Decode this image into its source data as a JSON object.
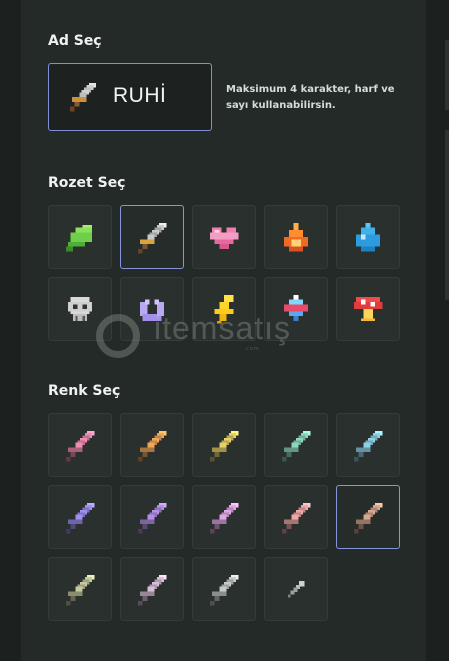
{
  "name_section": {
    "title": "Ad Seç",
    "value": "RUHİ",
    "hint": "Maksimum 4 karakter, harf ve sayı kullanabilirsin."
  },
  "badge_section": {
    "title": "Rozet Seç",
    "badges": [
      {
        "icon": "leaf-icon",
        "selected": false
      },
      {
        "icon": "sword-icon",
        "selected": true
      },
      {
        "icon": "heart-icon",
        "selected": false
      },
      {
        "icon": "fire-icon",
        "selected": false
      },
      {
        "icon": "water-drop-icon",
        "selected": false
      },
      {
        "icon": "skull-icon",
        "selected": false
      },
      {
        "icon": "crescent-moon-icon",
        "selected": false
      },
      {
        "icon": "lightning-icon",
        "selected": false
      },
      {
        "icon": "gem-icon",
        "selected": false
      },
      {
        "icon": "mushroom-icon",
        "selected": false
      }
    ]
  },
  "color_section": {
    "title": "Renk Seç",
    "colors": [
      {
        "blade": "#f08bb0",
        "selected": false
      },
      {
        "blade": "#f0a65a",
        "selected": false
      },
      {
        "blade": "#e6d068",
        "selected": false
      },
      {
        "blade": "#8fd6bf",
        "selected": false
      },
      {
        "blade": "#8fd0e6",
        "selected": false
      },
      {
        "blade": "#9f8ff0",
        "selected": false
      },
      {
        "blade": "#b38fe6",
        "selected": false
      },
      {
        "blade": "#e0a6e6",
        "selected": false
      },
      {
        "blade": "#f0a6a6",
        "selected": false
      },
      {
        "blade": "#d6a68f",
        "selected": true
      },
      {
        "blade": "#c6c99f",
        "selected": false
      },
      {
        "blade": "#d6bfd6",
        "selected": false
      },
      {
        "blade": "#c6cac8",
        "selected": false
      }
    ],
    "picker_icon": "eyedropper-icon"
  },
  "watermark": {
    "text": "itemsatış",
    "sub": "com"
  }
}
